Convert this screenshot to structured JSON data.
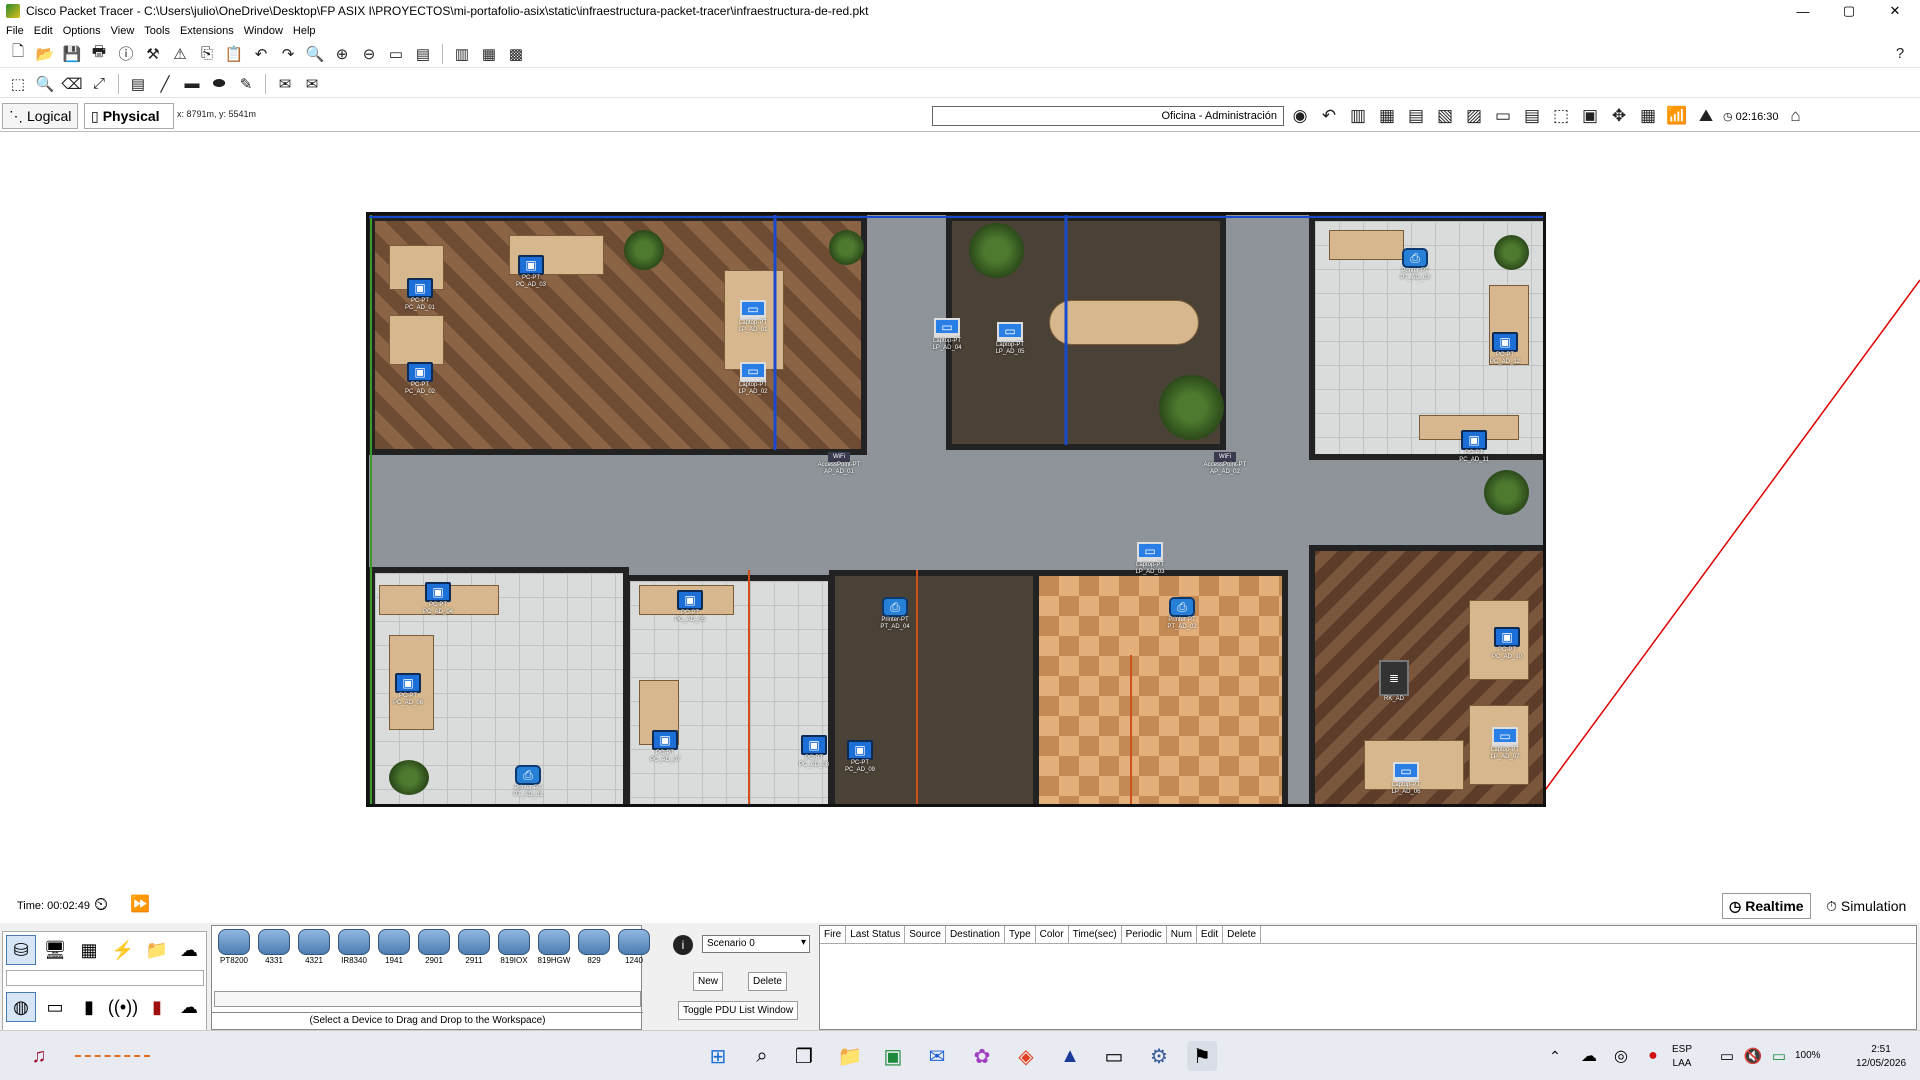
{
  "window": {
    "title": "Cisco Packet Tracer - C:\\Users\\julio\\OneDrive\\Desktop\\FP ASIX I\\PROYECTOS\\mi-portafolio-asix\\static\\infraestructura-packet-tracer\\infraestructura-de-red.pkt",
    "minimize": "—",
    "maximize": "▢",
    "close": "✕"
  },
  "menu": [
    "File",
    "Edit",
    "Options",
    "View",
    "Tools",
    "Extensions",
    "Window",
    "Help"
  ],
  "toolbar_help": "?",
  "view": {
    "logical_label": "Logical",
    "physical_label": "Physical",
    "cursor_coords": "x: 8791m, y: 5541m",
    "location": "Oficina - Administración",
    "clock": "02:16:30"
  },
  "devices": [
    {
      "id": "pc01",
      "type": "pc",
      "label": "PC-PT\nPC_AD_01"
    },
    {
      "id": "pc02",
      "type": "pc",
      "label": "PC-PT\nPC_AD_02"
    },
    {
      "id": "pc03",
      "type": "pc",
      "label": "PC-PT\nPC_AD_03"
    },
    {
      "id": "lp01",
      "type": "lap",
      "label": "Laptop-PT\nLP_AD_01"
    },
    {
      "id": "lp02",
      "type": "lap",
      "label": "Laptop-PT\nLP_AD_02"
    },
    {
      "id": "lp04",
      "type": "lap",
      "label": "Laptop-PT\nLP_AD_04"
    },
    {
      "id": "lp05",
      "type": "lap",
      "label": "Laptop-PT\nLP_AD_05"
    },
    {
      "id": "ap01",
      "type": "ap",
      "label": "AccessPoint-PT\nAP_AD_01",
      "badge": "WiFi"
    },
    {
      "id": "ap02",
      "type": "ap",
      "label": "AccessPoint-PT\nAP_AD_02",
      "badge": "WiFi"
    },
    {
      "id": "pt03",
      "type": "prn",
      "label": "Printer-PT\nPT_AD_03"
    },
    {
      "id": "pc12",
      "type": "pc",
      "label": "PC-PT\nPC_AD_12"
    },
    {
      "id": "pc11",
      "type": "pc",
      "label": "PC-PT\nPC_AD_11"
    },
    {
      "id": "pc04",
      "type": "pc",
      "label": "PC-PT\nPC_AD_04"
    },
    {
      "id": "pc05",
      "type": "pc",
      "label": "PC-PT\nPC_AD_05"
    },
    {
      "id": "pc06",
      "type": "pc",
      "label": "PC-PT\nPC_AD_06"
    },
    {
      "id": "pc07",
      "type": "pc",
      "label": "PC-PT\nPC_AD_07"
    },
    {
      "id": "pc08",
      "type": "pc",
      "label": "PC-PT\nPC_AD_08"
    },
    {
      "id": "pc09",
      "type": "pc",
      "label": "PC-PT\nPC_AD_09"
    },
    {
      "id": "pt01",
      "type": "prn",
      "label": "Printer-PT\nPT_AD_01"
    },
    {
      "id": "pt04",
      "type": "prn",
      "label": "Printer-PT\nPT_AD_04"
    },
    {
      "id": "pt02",
      "type": "prn",
      "label": "Printer-PT\nPT_AD_02"
    },
    {
      "id": "lp03",
      "type": "lap",
      "label": "Laptop-PT\nLP_AD_03"
    },
    {
      "id": "rk",
      "type": "rack",
      "label": "RK_AD"
    },
    {
      "id": "pc10",
      "type": "pc",
      "label": "PC-PT\nPC_AD_10"
    },
    {
      "id": "lp07",
      "type": "lap",
      "label": "Laptop-PT\nLP_AD_07"
    },
    {
      "id": "lp06",
      "type": "lap",
      "label": "Laptop-PT\nLP_AD_06"
    }
  ],
  "bottom": {
    "time": "Time: 00:02:49",
    "realtime": "Realtime",
    "simulation": "Simulation",
    "models": [
      "PT8200",
      "4331",
      "4321",
      "IR8340",
      "1941",
      "2901",
      "2911",
      "819IOX",
      "819HGW",
      "829",
      "1240"
    ],
    "hint": "(Select a Device to Drag and Drop to the Workspace)",
    "scenario": "Scenario 0",
    "new": "New",
    "delete": "Delete",
    "toggle_pdu": "Toggle PDU List Window",
    "pdu_columns": [
      "Fire",
      "Last Status",
      "Source",
      "Destination",
      "Type",
      "Color",
      "Time(sec)",
      "Periodic",
      "Num",
      "Edit",
      "Delete"
    ]
  },
  "taskbar": {
    "lang": "ESP",
    "lang2": "LAA",
    "battery": "100%",
    "time": "2:51",
    "date": "12/05/2026"
  }
}
